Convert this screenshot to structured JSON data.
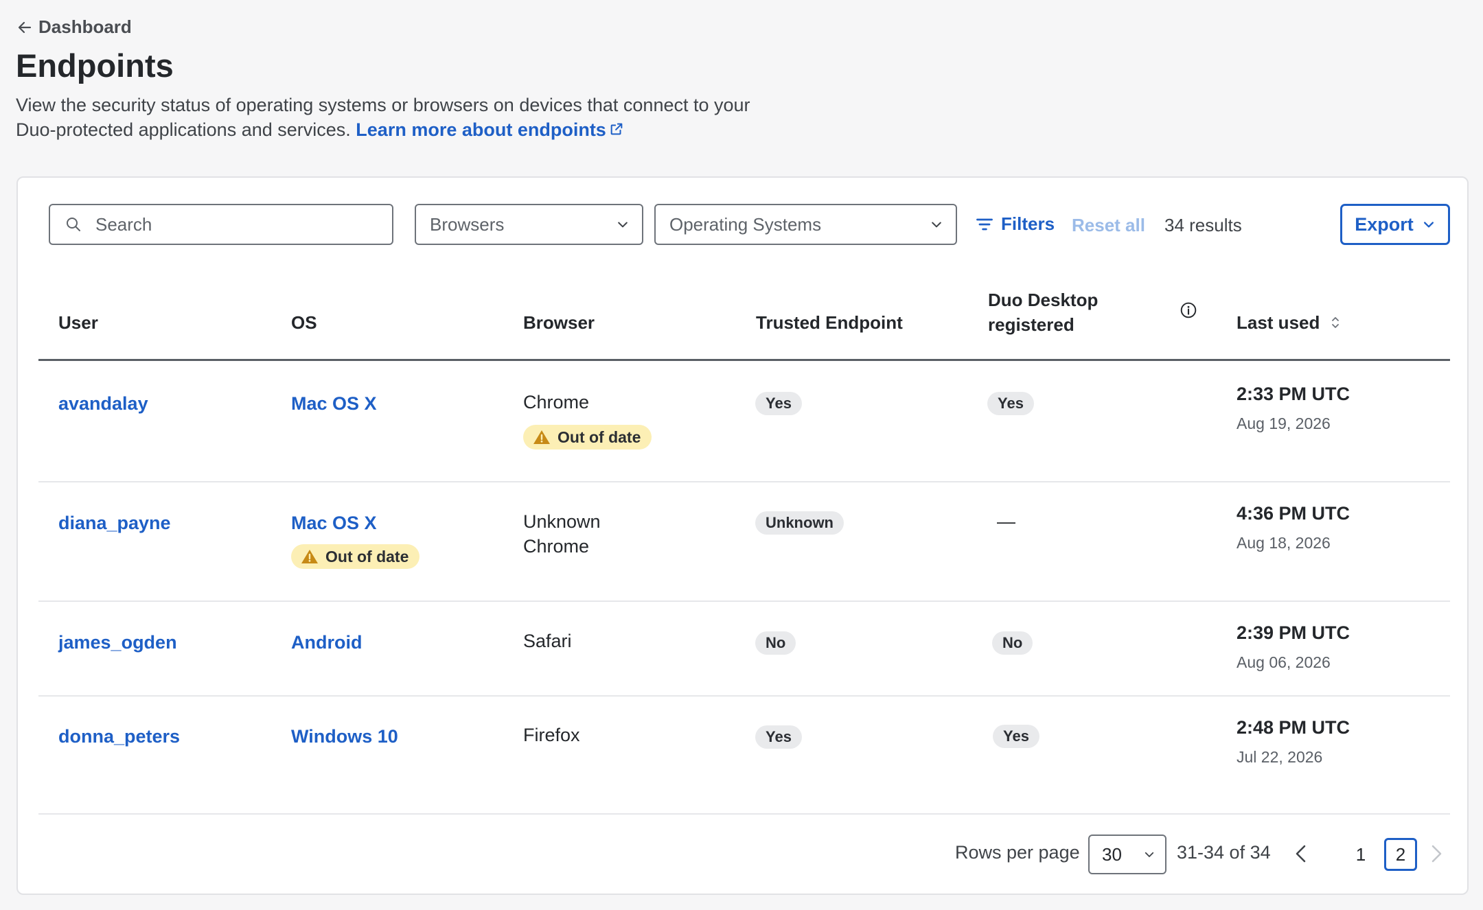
{
  "nav": {
    "back_label": "Dashboard"
  },
  "page": {
    "title": "Endpoints",
    "description": "View the security status of operating systems or browsers on devices that connect to your Duo-protected applications and services.",
    "learn_more": "Learn more about endpoints"
  },
  "toolbar": {
    "search_placeholder": "Search",
    "browsers_placeholder": "Browsers",
    "os_placeholder": "Operating Systems",
    "filters_label": "Filters",
    "reset_label": "Reset all",
    "results": "34 results",
    "export_label": "Export"
  },
  "table": {
    "headers": {
      "user": "User",
      "os": "OS",
      "browser": "Browser",
      "trusted": "Trusted Endpoint",
      "duo_desktop_line1": "Duo Desktop",
      "duo_desktop_line2": "registered",
      "last_used": "Last used"
    },
    "rows": [
      {
        "user": "avandalay",
        "os": "Mac OS X",
        "browser_lines": [
          "Chrome"
        ],
        "browser_warning": "Out of date",
        "trusted": "Yes",
        "duo_desktop": "Yes",
        "time": "2:33 PM UTC",
        "date": "Aug 19, 2026"
      },
      {
        "user": "diana_payne",
        "os": "Mac OS X",
        "os_warning": "Out of date",
        "browser_lines": [
          "Unknown",
          "Chrome"
        ],
        "trusted": "Unknown",
        "duo_desktop": "—",
        "time": "4:36 PM UTC",
        "date": "Aug 18, 2026"
      },
      {
        "user": "james_ogden",
        "os": "Android",
        "browser_lines": [
          "Safari"
        ],
        "trusted": "No",
        "duo_desktop": "No",
        "time": "2:39 PM UTC",
        "date": "Aug 06, 2026"
      },
      {
        "user": "donna_peters",
        "os": "Windows 10",
        "browser_lines": [
          "Firefox"
        ],
        "trusted": "Yes",
        "duo_desktop": "Yes",
        "time": "2:48 PM UTC",
        "date": "Jul 22, 2026"
      }
    ]
  },
  "pagination": {
    "rows_label": "Rows per page",
    "rows_value": "30",
    "range": "31-34 of 34",
    "pages": [
      "1",
      "2"
    ],
    "current_page": "2"
  },
  "colors": {
    "link": "#1e5fc6",
    "warning_bg": "#fcefb5",
    "warning_icon": "#c78a16",
    "pill_bg": "#e9eaec"
  }
}
